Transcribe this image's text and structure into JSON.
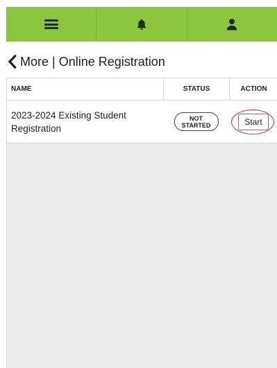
{
  "nav": {
    "items": [
      {
        "icon": "hamburger-menu-icon"
      },
      {
        "icon": "bell-icon"
      },
      {
        "icon": "user-icon"
      }
    ],
    "accent_color": "#8cc63f"
  },
  "page": {
    "title": "More | Online Registration",
    "back_icon": "chevron-left-icon"
  },
  "table": {
    "columns": [
      "NAME",
      "STATUS",
      "ACTION"
    ],
    "rows": [
      {
        "name": "2023-2024 Existing Student Registration",
        "status_line1": "NOT",
        "status_line2": "STARTED",
        "action": "Start"
      }
    ],
    "highlight_color": "#d22b2b"
  }
}
